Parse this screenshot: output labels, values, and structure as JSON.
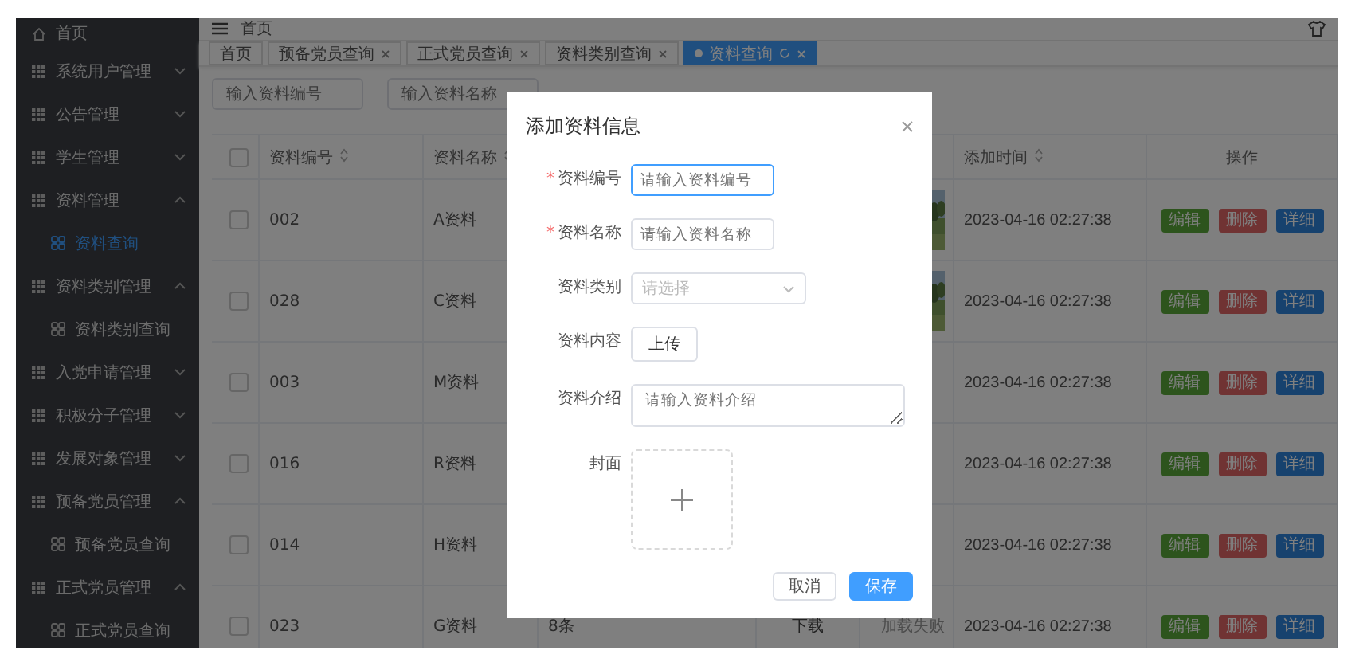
{
  "header": {
    "breadcrumb": "首页"
  },
  "sidebar": {
    "items": [
      {
        "label": "首页",
        "kind": "home"
      },
      {
        "label": "系统用户管理",
        "kind": "group",
        "expanded": false
      },
      {
        "label": "公告管理",
        "kind": "group",
        "expanded": false
      },
      {
        "label": "学生管理",
        "kind": "group",
        "expanded": false
      },
      {
        "label": "资料管理",
        "kind": "group",
        "expanded": true,
        "children": [
          {
            "label": "资料查询",
            "selected": true
          }
        ]
      },
      {
        "label": "资料类别管理",
        "kind": "group",
        "expanded": true,
        "children": [
          {
            "label": "资料类别查询",
            "selected": false
          }
        ]
      },
      {
        "label": "入党申请管理",
        "kind": "group",
        "expanded": false
      },
      {
        "label": "积极分子管理",
        "kind": "group",
        "expanded": false
      },
      {
        "label": "发展对象管理",
        "kind": "group",
        "expanded": false
      },
      {
        "label": "预备党员管理",
        "kind": "group",
        "expanded": true,
        "children": [
          {
            "label": "预备党员查询",
            "selected": false
          }
        ]
      },
      {
        "label": "正式党员管理",
        "kind": "group",
        "expanded": true,
        "children": [
          {
            "label": "正式党员查询",
            "selected": false
          }
        ]
      }
    ]
  },
  "tabs": [
    {
      "label": "首页",
      "selected": false,
      "closable": false
    },
    {
      "label": "预备党员查询",
      "selected": false,
      "closable": true
    },
    {
      "label": "正式党员查询",
      "selected": false,
      "closable": true
    },
    {
      "label": "资料类别查询",
      "selected": false,
      "closable": true
    },
    {
      "label": "资料查询",
      "selected": true,
      "closable": true
    }
  ],
  "search": [
    {
      "placeholder": "输入资料编号"
    },
    {
      "placeholder": "输入资料名称"
    }
  ],
  "table": {
    "all_checked": false,
    "columns": [
      "资料编号",
      "资料名称",
      "添加时间",
      "操作"
    ],
    "rows": [
      {
        "checked": false,
        "code": "002",
        "name": "A资料",
        "cover": {
          "kind": "picture"
        },
        "time": "2023-04-16 02:27:38",
        "actions": [
          {
            "label": "编辑",
            "kind": "edit"
          },
          {
            "label": "删除",
            "kind": "delete"
          },
          {
            "label": "详细",
            "kind": "detail"
          }
        ]
      },
      {
        "checked": false,
        "code": "028",
        "name": "C资料",
        "cover": {
          "kind": "picture"
        },
        "time": "2023-04-16 02:27:38",
        "actions": [
          {
            "label": "编辑",
            "kind": "edit"
          },
          {
            "label": "删除",
            "kind": "delete"
          },
          {
            "label": "详细",
            "kind": "detail"
          }
        ]
      },
      {
        "checked": false,
        "code": "003",
        "name": "M资料",
        "time": "2023-04-16 02:27:38",
        "actions": [
          {
            "label": "编辑",
            "kind": "edit"
          },
          {
            "label": "删除",
            "kind": "delete"
          },
          {
            "label": "详细",
            "kind": "detail"
          }
        ]
      },
      {
        "checked": false,
        "code": "016",
        "name": "R资料",
        "time": "2023-04-16 02:27:38",
        "actions": [
          {
            "label": "编辑",
            "kind": "edit"
          },
          {
            "label": "删除",
            "kind": "delete"
          },
          {
            "label": "详细",
            "kind": "detail"
          }
        ]
      },
      {
        "checked": false,
        "code": "014",
        "name": "H资料",
        "time": "2023-04-16 02:27:38",
        "actions": [
          {
            "label": "编辑",
            "kind": "edit"
          },
          {
            "label": "删除",
            "kind": "delete"
          },
          {
            "label": "详细",
            "kind": "detail"
          }
        ]
      },
      {
        "checked": false,
        "code": "023",
        "name": "G资料",
        "column_3": "8条",
        "content": "下载",
        "cover_text": "加载失败",
        "time": "2023-04-16 02:27:38",
        "actions": [
          {
            "label": "编辑",
            "kind": "edit"
          },
          {
            "label": "删除",
            "kind": "delete"
          },
          {
            "label": "详细",
            "kind": "detail"
          }
        ]
      }
    ]
  },
  "dialog": {
    "title": "添加资料信息",
    "fields": [
      {
        "label": "资料编号",
        "marker": "*",
        "kind": "input",
        "placeholder": "请输入资料编号",
        "focused": true
      },
      {
        "label": "资料名称",
        "marker": "*",
        "kind": "input",
        "placeholder": "请输入资料名称",
        "focused": false
      },
      {
        "label": "资料类别",
        "kind": "select",
        "placeholder": "请选择"
      },
      {
        "label": "资料内容",
        "kind": "upload",
        "button": "上传"
      },
      {
        "label": "资料介绍",
        "kind": "textarea",
        "placeholder": "请输入资料介绍"
      },
      {
        "label": "封面"
      }
    ],
    "buttons": [
      {
        "label": "取消",
        "kind": "default"
      },
      {
        "label": "保存",
        "kind": "primary"
      }
    ]
  }
}
